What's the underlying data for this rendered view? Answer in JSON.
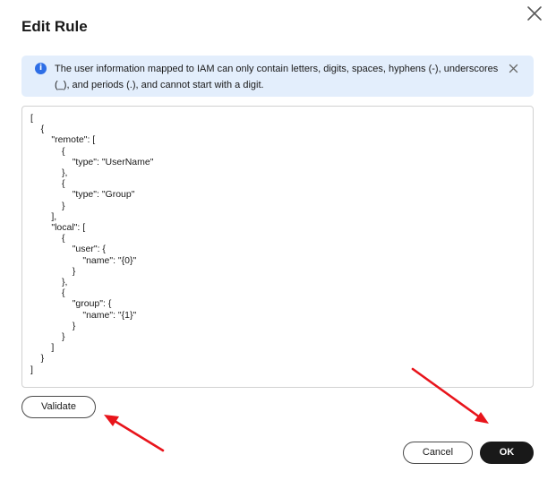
{
  "dialog": {
    "title": "Edit Rule"
  },
  "notice": {
    "text": "The user information mapped to IAM can only contain letters, digits, spaces, hyphens (-), underscores (_), and periods (.), and cannot start with a digit."
  },
  "editor": {
    "content": "[\n\t{\n\t\t\"remote\": [\n\t\t\t{\n\t\t\t\t\"type\": \"UserName\"\n\t\t\t},\n\t\t\t{\n\t\t\t\t\"type\": \"Group\"\n\t\t\t}\n\t\t],\n\t\t\"local\": [\n\t\t\t{\n\t\t\t\t\"user\": {\n\t\t\t\t\t\"name\": \"{0}\"\n\t\t\t\t}\n\t\t\t},\n\t\t\t{\n\t\t\t\t\"group\": {\n\t\t\t\t\t\"name\": \"{1}\"\n\t\t\t\t}\n\t\t\t}\n\t\t]\n\t}\n]"
  },
  "buttons": {
    "validate": "Validate",
    "cancel": "Cancel",
    "ok": "OK"
  },
  "icons": {
    "close": "close-icon",
    "info": "info-icon",
    "annotation_arrow": "red-arrow"
  },
  "colors": {
    "notice_bg": "#e3eefc",
    "info_blue": "#2e6ee6",
    "primary_button": "#191919",
    "annotation_red": "#e8141b"
  }
}
